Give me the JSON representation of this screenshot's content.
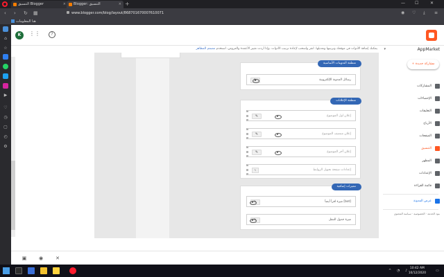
{
  "browser": {
    "tabs": [
      {
        "label": "التنسيق Blogger"
      },
      {
        "label": "Blogger: التنسيق"
      }
    ],
    "url": "www.blogger.com/blog/layout/868701670007610071",
    "bookmark": "هنا المعلومات"
  },
  "header": {
    "avatar_letter": "K"
  },
  "notice": {
    "text": "يمكنك إضافة الأدوات في موقعك وترتيبها وتعديلها. انقر واسحب لإعادة ترتيب الأدوات. وإذا أردت تغيير الأعمدة والعروض، استخدم",
    "link": "مصمم المظاهر"
  },
  "nav": {
    "blog_name": "AppMarket",
    "new_post": "مشاركة جديدة",
    "items": [
      {
        "label": "المشاركات"
      },
      {
        "label": "الإحصاءات"
      },
      {
        "label": "التعليقات"
      },
      {
        "label": "الأرباح"
      },
      {
        "label": "الصفحات"
      },
      {
        "label": "التنسيق"
      },
      {
        "label": "المظهر"
      },
      {
        "label": "الإعدادات"
      },
      {
        "label": "قائمة القراءة"
      }
    ],
    "view_blog": "عرض المدونة",
    "footer": "بنود الخدمة · الخصوصية · سياسة المحتوى"
  },
  "sections": [
    {
      "title": "منطقة التدوينات الأساسية",
      "gadgets": [
        {
          "label": "رسائل المدونة الإلكترونية"
        }
      ]
    },
    {
      "title": "منطقة الإعلانات",
      "gadgets": [
        {
          "label": "إعلان اول الموضوع"
        },
        {
          "label": "إعلان منتصف الموضوع"
        },
        {
          "label": "إعلان آخر الموضوع"
        },
        {
          "label": "إعدادات صفحة تحويل الروابط"
        }
      ]
    },
    {
      "title": "مميزات إضافية",
      "gadgets": [
        {
          "label": "ميزة اقرأ أيضاَ [bot]"
        },
        {
          "label": "ميزة جدول التنقل"
        }
      ]
    }
  ],
  "taskbar": {
    "time": "10:42 AM",
    "date": "10/12/2020"
  },
  "colors": {
    "brand": "#ff5722",
    "section_header": "#3367b5",
    "link": "#3c72c9"
  }
}
